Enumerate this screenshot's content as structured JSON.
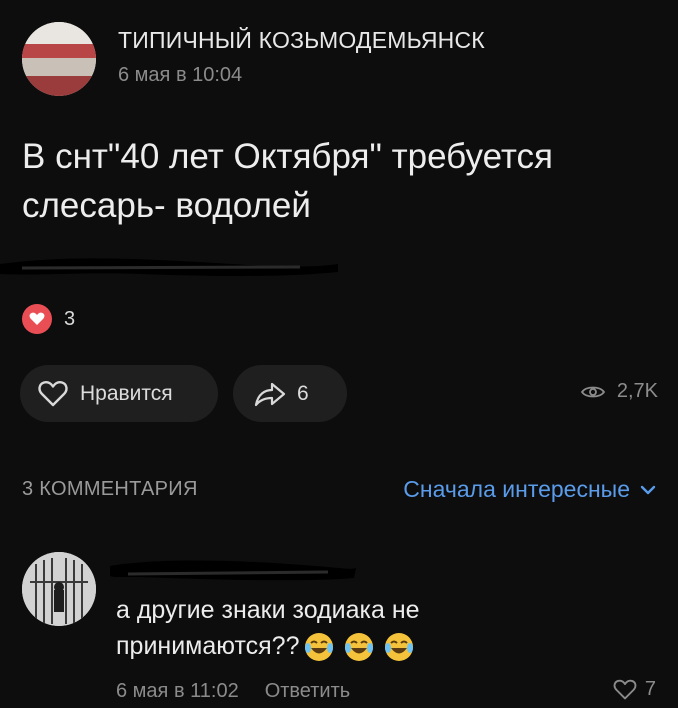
{
  "post": {
    "group_name": "ТИПИЧНЫЙ КОЗЬМОДЕМЬЯНСК",
    "time": "6 мая в 10:04",
    "text_line1": "В снт\"40 лет Октября\" требуется",
    "text_line2": "слесарь- водолей",
    "reactions_count": "3",
    "like_label": "Нравится",
    "share_count": "6",
    "views": "2,7K"
  },
  "comments": {
    "header": "3 КОММЕНТАРИЯ",
    "sort_label": "Сначала интересные",
    "items": [
      {
        "text_line1": "а другие знаки зодиака не",
        "text_line2": "принимаются??",
        "time": "6 мая в 11:02",
        "reply_label": "Ответить",
        "likes": "7"
      }
    ]
  },
  "colors": {
    "background": "#0d0d0d",
    "accent": "#5a9bea",
    "heart": "#ea4e55"
  },
  "icons": [
    "heart-icon",
    "share-arrow-icon",
    "eye-icon",
    "chevron-down-icon",
    "laughing-emoji-icon"
  ]
}
